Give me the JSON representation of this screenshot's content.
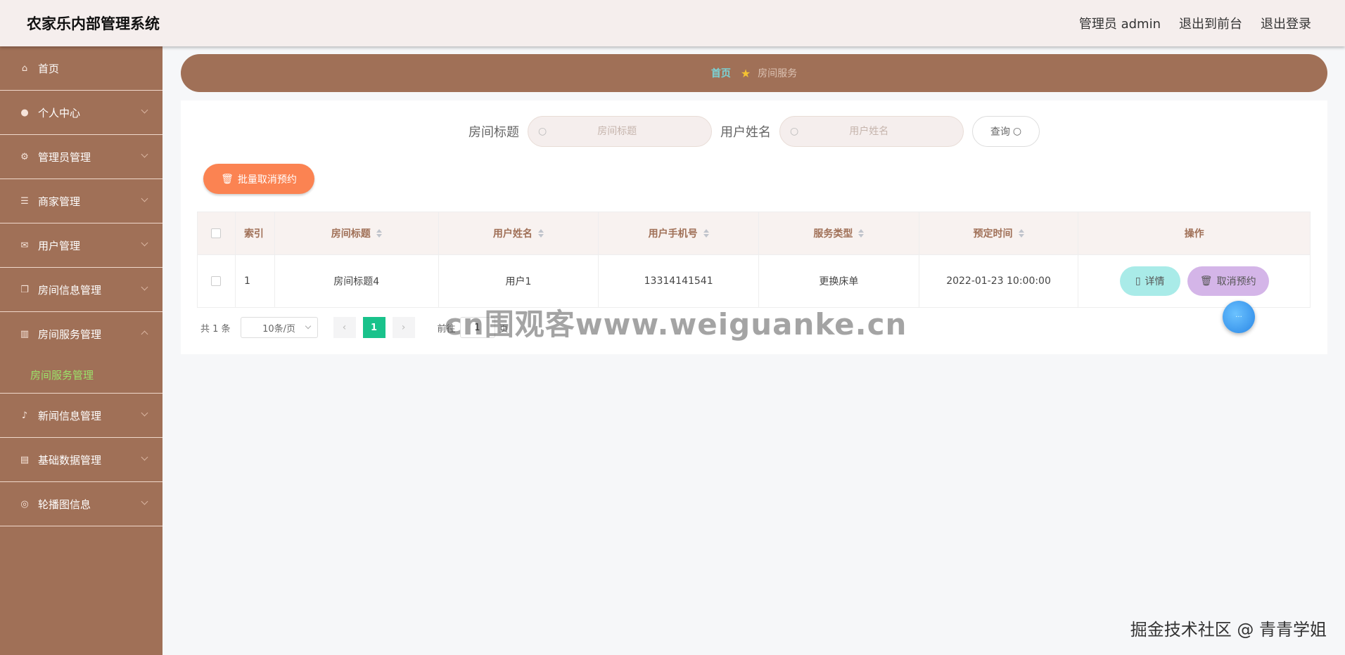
{
  "header": {
    "app_title": "农家乐内部管理系统",
    "user_label": "管理员 admin",
    "to_front_label": "退出到前台",
    "logout_label": "退出登录"
  },
  "sidebar": {
    "items": [
      {
        "label": "首页",
        "icon": "home-icon"
      },
      {
        "label": "个人中心",
        "icon": "user-icon"
      },
      {
        "label": "管理员管理",
        "icon": "gear-icon"
      },
      {
        "label": "商家管理",
        "icon": "sliders-icon"
      },
      {
        "label": "用户管理",
        "icon": "mail-icon"
      },
      {
        "label": "房间信息管理",
        "icon": "copy-icon"
      },
      {
        "label": "房间服务管理",
        "icon": "bar-chart-icon"
      },
      {
        "label": "新闻信息管理",
        "icon": "mic-icon"
      },
      {
        "label": "基础数据管理",
        "icon": "cake-icon"
      },
      {
        "label": "轮播图信息",
        "icon": "compass-icon"
      }
    ],
    "active_sub": "房间服务管理"
  },
  "breadcrumb": {
    "home": "首页",
    "current": "房间服务"
  },
  "search": {
    "title_label": "房间标题",
    "title_placeholder": "房间标题",
    "user_label": "用户姓名",
    "user_placeholder": "用户姓名",
    "query_label": "查询"
  },
  "toolbar": {
    "batch_cancel_label": "批量取消预约"
  },
  "table": {
    "columns": [
      "索引",
      "房间标题",
      "用户姓名",
      "用户手机号",
      "服务类型",
      "预定时间",
      "操作"
    ],
    "rows": [
      {
        "index": "1",
        "room_title": "房间标题4",
        "user_name": "用户1",
        "phone": "13314141541",
        "service_type": "更换床单",
        "time": "2022-01-23 10:00:00"
      }
    ],
    "detail_label": "详情",
    "cancel_label": "取消预约"
  },
  "pager": {
    "total": "共 1 条",
    "page_size": "10条/页",
    "current_page": "1",
    "goto_prefix": "前往",
    "goto_value": "1",
    "goto_suffix": "页"
  },
  "watermark": "cn围观客www.weiguanke.cn",
  "credit": "掘金技术社区 @ 青青学姐",
  "colors": {
    "sidebar_bg": "#a07057",
    "header_bg": "#f5eeed",
    "active_sub": "#9be36a",
    "batch_btn": "#fb8352",
    "detail_btn": "#a9ebe8",
    "cancel_btn": "#d4b5e8",
    "page_active": "#19c28b"
  }
}
